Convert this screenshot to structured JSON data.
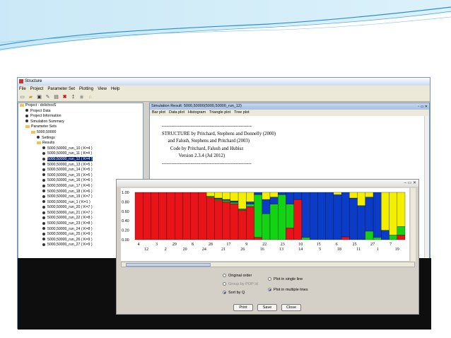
{
  "window": {
    "title": "Structure"
  },
  "menubar": {
    "items": [
      "File",
      "Project",
      "Parameter Set",
      "Plotting",
      "View",
      "Help"
    ]
  },
  "tree": {
    "nodes": [
      {
        "label": "Project - dolichosS",
        "level": 0,
        "kind": "folder",
        "selected": false
      },
      {
        "label": "Project Data",
        "level": 1,
        "kind": "dot",
        "selected": false
      },
      {
        "label": "Project Information",
        "level": 1,
        "kind": "dot",
        "selected": false
      },
      {
        "label": "Simulation Summary",
        "level": 1,
        "kind": "dot",
        "selected": false
      },
      {
        "label": "Parameter Sets",
        "level": 1,
        "kind": "folder",
        "selected": false
      },
      {
        "label": "5000,50000",
        "level": 2,
        "kind": "folder",
        "selected": false
      },
      {
        "label": "Settings",
        "level": 3,
        "kind": "dot",
        "selected": false
      },
      {
        "label": "Results",
        "level": 3,
        "kind": "folder",
        "selected": false
      },
      {
        "label": "5000,50000_run_10 ( K=4 )",
        "level": 4,
        "kind": "dot",
        "selected": false
      },
      {
        "label": "5000,50000_run_11 ( K=4 )",
        "level": 4,
        "kind": "dot",
        "selected": false
      },
      {
        "label": "5000,50000_run_12 ( K=4 )",
        "level": 4,
        "kind": "dot",
        "selected": true
      },
      {
        "label": "5000,50000_run_13 ( K=5 )",
        "level": 4,
        "kind": "dot",
        "selected": false
      },
      {
        "label": "5000,50000_run_14 ( K=5 )",
        "level": 4,
        "kind": "dot",
        "selected": false
      },
      {
        "label": "5000,50000_run_15 ( K=5 )",
        "level": 4,
        "kind": "dot",
        "selected": false
      },
      {
        "label": "5000,50000_run_16 ( K=6 )",
        "level": 4,
        "kind": "dot",
        "selected": false
      },
      {
        "label": "5000,50000_run_17 ( K=6 )",
        "level": 4,
        "kind": "dot",
        "selected": false
      },
      {
        "label": "5000,50000_run_18 ( K=6 )",
        "level": 4,
        "kind": "dot",
        "selected": false
      },
      {
        "label": "5000,50000_run_19 ( K=7 )",
        "level": 4,
        "kind": "dot",
        "selected": false
      },
      {
        "label": "5000,50000_run_1 ( K=1 )",
        "level": 4,
        "kind": "dot",
        "selected": false
      },
      {
        "label": "5000,50000_run_20 ( K=7 )",
        "level": 4,
        "kind": "dot",
        "selected": false
      },
      {
        "label": "5000,50000_run_21 ( K=7 )",
        "level": 4,
        "kind": "dot",
        "selected": false
      },
      {
        "label": "5000,50000_run_22 ( K=8 )",
        "level": 4,
        "kind": "dot",
        "selected": false
      },
      {
        "label": "5000,50000_run_23 ( K=8 )",
        "level": 4,
        "kind": "dot",
        "selected": false
      },
      {
        "label": "5000,50000_run_24 ( K=8 )",
        "level": 4,
        "kind": "dot",
        "selected": false
      },
      {
        "label": "5000,50000_run_25 ( K=9 )",
        "level": 4,
        "kind": "dot",
        "selected": false
      },
      {
        "label": "5000,50000_run_26 ( K=9 )",
        "level": 4,
        "kind": "dot",
        "selected": false
      },
      {
        "label": "5000,50000_run_27 ( K=9 )",
        "level": 4,
        "kind": "dot",
        "selected": false
      }
    ]
  },
  "simulation": {
    "title": "Simulation Result: 5000,50000(5000,50000_run_12)",
    "tabs": [
      "Bar plot",
      "Data plot",
      "Histogram",
      "Triangle plot",
      "Tree plot"
    ],
    "text_lines": [
      "--------------------------------------------------------",
      "STRUCTURE by Pritchard, Stephens and Donnelly (2000)",
      "     and Falush, Stephens and Pritchard (2003)",
      "       Code by Pritchard, Falush and Hubisz",
      "              Version 2.3.4 (Jul 2012)",
      "--------------------------------------------------------"
    ]
  },
  "options": {
    "original_order": "Original order",
    "group_by_pop": "Group by POP Id",
    "sort_by_q": "Sort by Q",
    "single_line": "Plot in single line",
    "multiple_lines": "Plot in multiple lines"
  },
  "buttons": {
    "print": "Print",
    "save": "Save",
    "close": "Close"
  },
  "colors": {
    "red": "#e8141a",
    "green": "#14d214",
    "blue": "#0a3cc8",
    "yellow": "#f2f000"
  },
  "chart_data": {
    "type": "bar",
    "stacked": true,
    "y_ticks": [
      "1.00",
      "0.80",
      "0.60",
      "0.40",
      "0.20",
      "0.00"
    ],
    "ylim": [
      0,
      1
    ],
    "grid": false,
    "series_colors": [
      "#e8141a",
      "#14d214",
      "#0a3cc8",
      "#f2f000"
    ],
    "x_labels_top": [
      "4",
      "3",
      "29",
      "8",
      "28",
      "17",
      "9",
      "22",
      "23",
      "10",
      "15",
      "6",
      "25",
      "27",
      "7"
    ],
    "x_labels_bottom": [
      "12",
      "2",
      "20",
      "24",
      "21",
      "26",
      "16",
      "13",
      "14",
      "5",
      "18",
      "11",
      "1",
      "19"
    ],
    "bars": [
      [
        1,
        0,
        0,
        0
      ],
      [
        1,
        0,
        0,
        0
      ],
      [
        1,
        0,
        0,
        0
      ],
      [
        1,
        0,
        0,
        0
      ],
      [
        1,
        0,
        0,
        0
      ],
      [
        1,
        0,
        0,
        0
      ],
      [
        1,
        0,
        0,
        0
      ],
      [
        1,
        0,
        0,
        0
      ],
      [
        1,
        0,
        0,
        0
      ],
      [
        0.9,
        0.02,
        0,
        0.08
      ],
      [
        0.84,
        0.02,
        0.02,
        0.12
      ],
      [
        0.8,
        0.03,
        0.02,
        0.15
      ],
      [
        0.76,
        0.03,
        0.03,
        0.18
      ],
      [
        0.62,
        0.02,
        0.01,
        0.35
      ],
      [
        0.7,
        0.05,
        0.05,
        0.2
      ],
      [
        0.05,
        0.9,
        0.05,
        0
      ],
      [
        0,
        0.55,
        0.3,
        0.15
      ],
      [
        0,
        0.75,
        0.15,
        0.1
      ],
      [
        0,
        0.95,
        0.05,
        0
      ],
      [
        0.25,
        0.5,
        0.25,
        0
      ],
      [
        0.85,
        0,
        0.15,
        0
      ],
      [
        0,
        0.05,
        0.95,
        0
      ],
      [
        0,
        0,
        1,
        0
      ],
      [
        0,
        0,
        1,
        0
      ],
      [
        0,
        0,
        1,
        0
      ],
      [
        0,
        0,
        0.95,
        0.05
      ],
      [
        0.06,
        0,
        0.94,
        0
      ],
      [
        0,
        0,
        0.88,
        0.12
      ],
      [
        0,
        0,
        0.72,
        0.28
      ],
      [
        0,
        0.18,
        0.72,
        0.1
      ],
      [
        0,
        0.05,
        0.95,
        0
      ],
      [
        0,
        0,
        0.2,
        0.8
      ],
      [
        0,
        0.1,
        0,
        0.9
      ],
      [
        0.1,
        0.18,
        0,
        0.72
      ]
    ]
  }
}
